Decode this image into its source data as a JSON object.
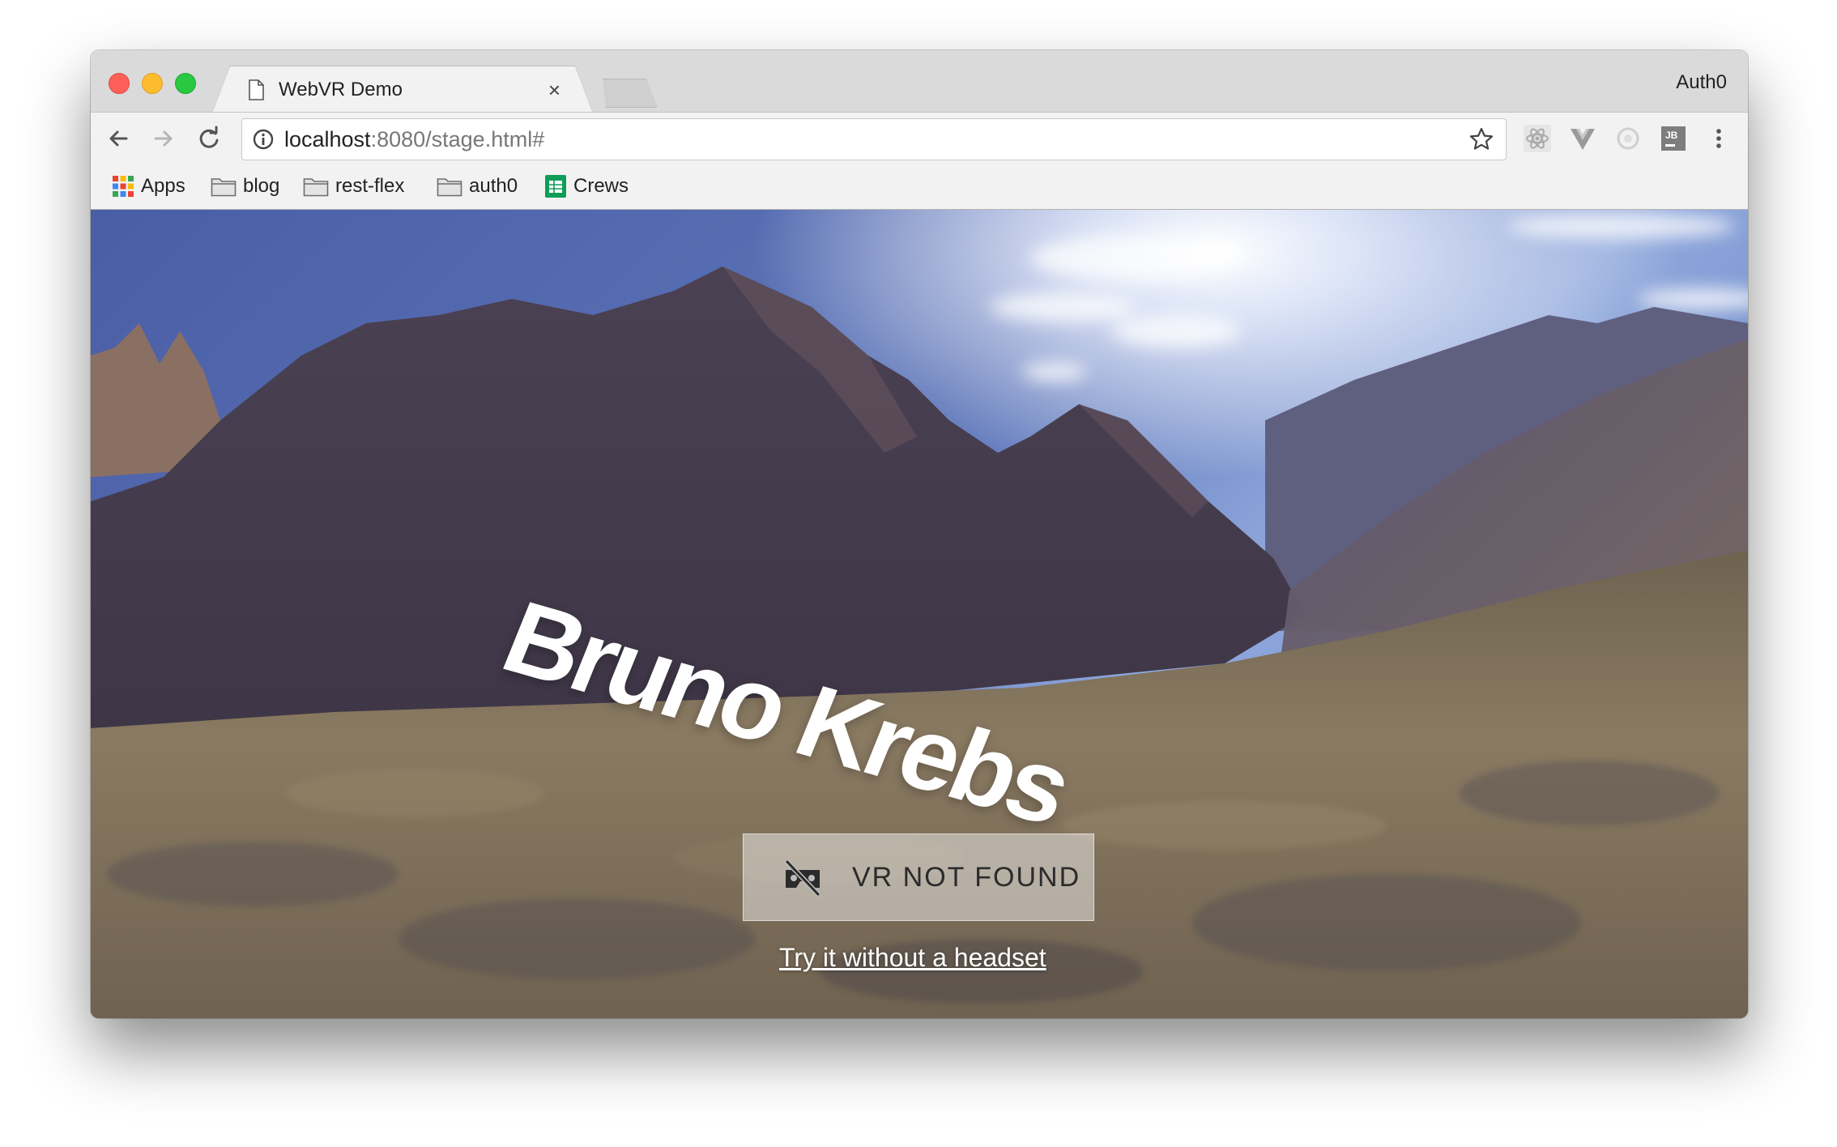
{
  "browser": {
    "tab": {
      "title": "WebVR Demo",
      "close_glyph": "×"
    },
    "profile_name": "Auth0",
    "address": {
      "host": "localhost",
      "rest": ":8080/stage.html#"
    },
    "bookmarks": [
      {
        "label": "Apps",
        "icon": "apps-grid-icon"
      },
      {
        "label": "blog",
        "icon": "folder-icon"
      },
      {
        "label": "rest-flex",
        "icon": "folder-icon"
      },
      {
        "label": "auth0",
        "icon": "folder-icon"
      },
      {
        "label": "Crews",
        "icon": "sheets-icon"
      }
    ],
    "extensions": [
      "react-devtools-icon",
      "vue-devtools-icon",
      "redux-devtools-icon",
      "jetbrains-icon",
      "menu-kebab-icon"
    ],
    "colors": {
      "close": "#fc5f57",
      "minimize": "#fdbc2e",
      "maximize": "#28c840"
    }
  },
  "page": {
    "name_text": "Bruno Krebs",
    "vr_button_label": "VR NOT FOUND",
    "try_link": "Try it without a headset"
  }
}
